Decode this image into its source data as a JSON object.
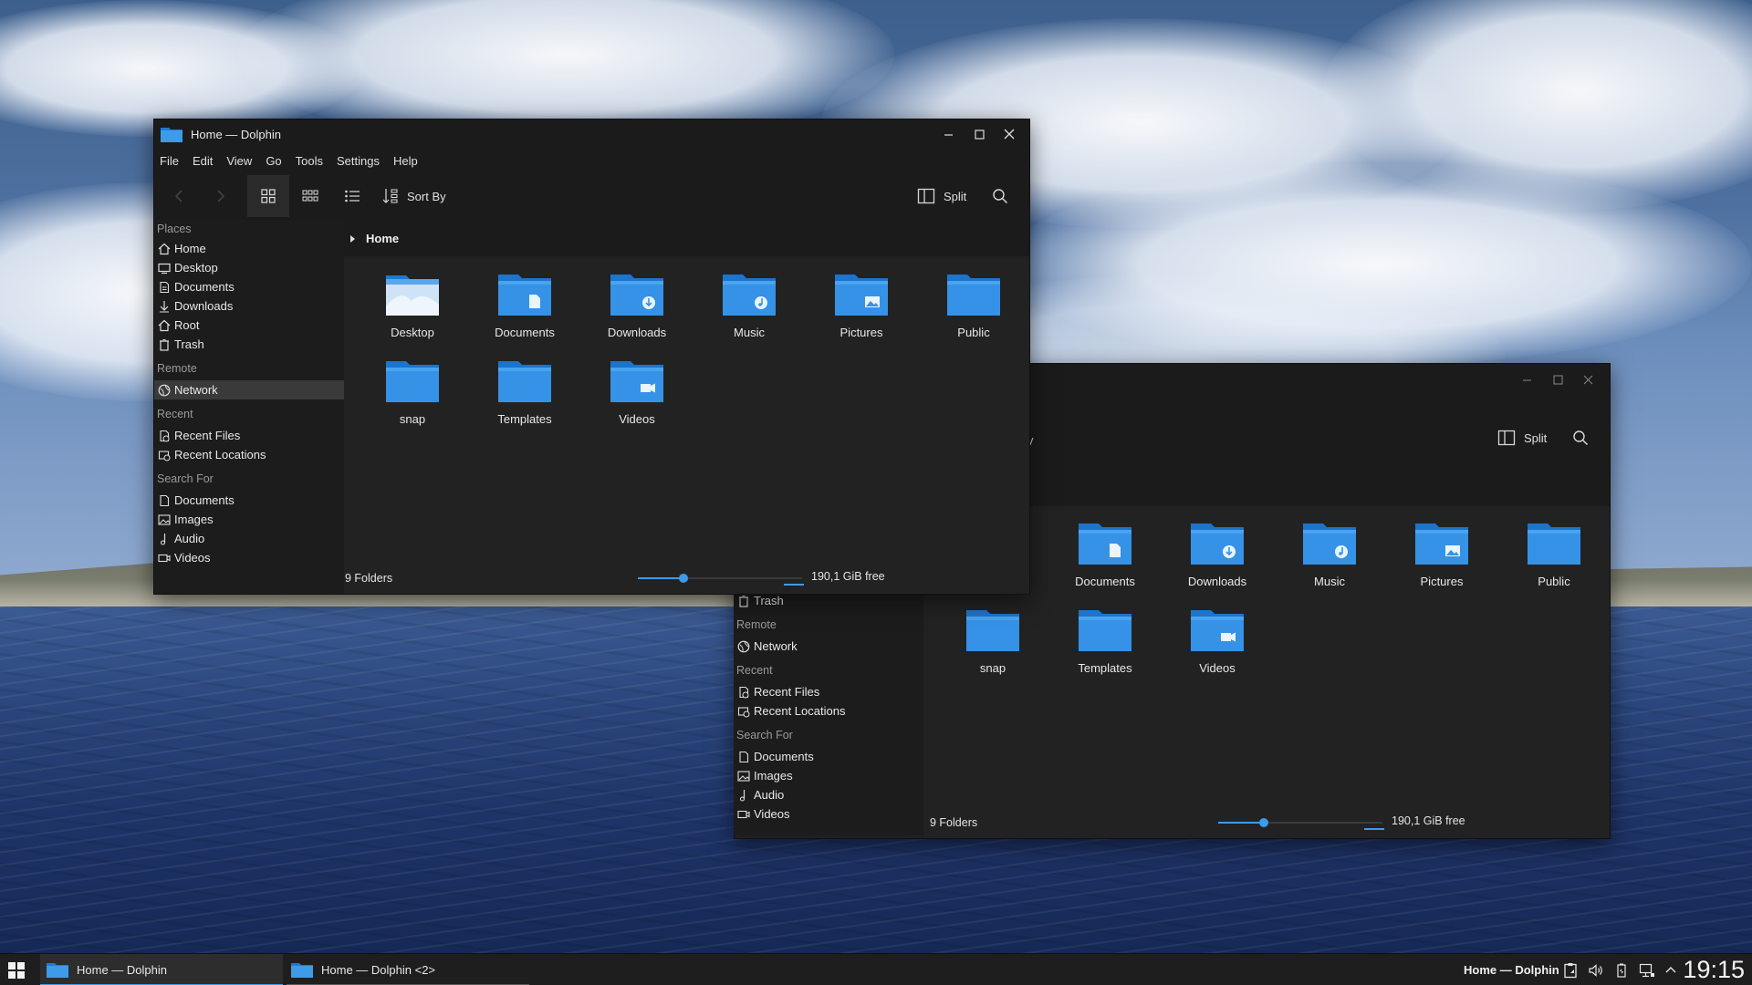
{
  "window_front": {
    "title": "Home — Dolphin",
    "menu": [
      "File",
      "Edit",
      "View",
      "Go",
      "Tools",
      "Settings",
      "Help"
    ],
    "toolbar": {
      "sort_label": "Sort By",
      "split_label": "Split"
    },
    "breadcrumb": "Home",
    "sidebar": {
      "places_heading": "Places",
      "places": [
        {
          "label": "Home",
          "icon": "home-icon"
        },
        {
          "label": "Desktop",
          "icon": "desktop-icon"
        },
        {
          "label": "Documents",
          "icon": "documents-icon"
        },
        {
          "label": "Downloads",
          "icon": "downloads-icon"
        },
        {
          "label": "Root",
          "icon": "root-icon"
        },
        {
          "label": "Trash",
          "icon": "trash-icon"
        }
      ],
      "remote_heading": "Remote",
      "remote": [
        {
          "label": "Network",
          "icon": "network-icon",
          "selected": true
        }
      ],
      "recent_heading": "Recent",
      "recent": [
        {
          "label": "Recent Files",
          "icon": "recent-files-icon"
        },
        {
          "label": "Recent Locations",
          "icon": "recent-locations-icon"
        }
      ],
      "search_heading": "Search For",
      "search": [
        {
          "label": "Documents",
          "icon": "search-documents-icon"
        },
        {
          "label": "Images",
          "icon": "images-icon"
        },
        {
          "label": "Audio",
          "icon": "audio-icon"
        },
        {
          "label": "Videos",
          "icon": "videos-icon"
        }
      ]
    },
    "folders": [
      {
        "label": "Desktop",
        "icon": "desktop-folder-icon"
      },
      {
        "label": "Documents",
        "icon": "documents-folder-icon"
      },
      {
        "label": "Downloads",
        "icon": "downloads-folder-icon"
      },
      {
        "label": "Music",
        "icon": "music-folder-icon"
      },
      {
        "label": "Pictures",
        "icon": "pictures-folder-icon"
      },
      {
        "label": "Public",
        "icon": "public-folder-icon"
      },
      {
        "label": "snap",
        "icon": "folder-icon"
      },
      {
        "label": "Templates",
        "icon": "templates-folder-icon"
      },
      {
        "label": "Videos",
        "icon": "videos-folder-icon"
      }
    ],
    "status": {
      "count": "9 Folders",
      "free": "190,1 GiB free",
      "zoom_fraction": 0.28
    }
  },
  "window_back": {
    "toolbar_fragment": "y",
    "toolbar": {
      "split_label": "Split"
    },
    "sidebar": {
      "places_visible": [
        {
          "label": "Trash",
          "icon": "trash-icon"
        }
      ],
      "remote_heading": "Remote",
      "remote": [
        {
          "label": "Network",
          "icon": "network-icon"
        }
      ],
      "recent_heading": "Recent",
      "recent": [
        {
          "label": "Recent Files",
          "icon": "recent-files-icon"
        },
        {
          "label": "Recent Locations",
          "icon": "recent-locations-icon"
        }
      ],
      "search_heading": "Search For",
      "search": [
        {
          "label": "Documents",
          "icon": "search-documents-icon"
        },
        {
          "label": "Images",
          "icon": "images-icon"
        },
        {
          "label": "Audio",
          "icon": "audio-icon"
        },
        {
          "label": "Videos",
          "icon": "videos-icon"
        }
      ]
    },
    "folders": [
      {
        "label": "Documents",
        "icon": "documents-folder-icon"
      },
      {
        "label": "Downloads",
        "icon": "downloads-folder-icon"
      },
      {
        "label": "Music",
        "icon": "music-folder-icon"
      },
      {
        "label": "Pictures",
        "icon": "pictures-folder-icon"
      },
      {
        "label": "Public",
        "icon": "public-folder-icon"
      },
      {
        "label": "snap",
        "icon": "folder-icon"
      },
      {
        "label": "Templates",
        "icon": "templates-folder-icon"
      },
      {
        "label": "Videos",
        "icon": "videos-folder-icon"
      }
    ],
    "status": {
      "count": "9 Folders",
      "free": "190,1 GiB free",
      "zoom_fraction": 0.28
    }
  },
  "taskbar": {
    "tasks": [
      {
        "label": "Home — Dolphin",
        "active": true
      },
      {
        "label": "Home — Dolphin <2>",
        "active": false
      }
    ],
    "active_window_title": "Home — Dolphin",
    "clock": "19:15",
    "tray_icons": [
      "clipboard-icon",
      "volume-icon",
      "battery-icon",
      "network-tray-icon",
      "expand-tray-icon"
    ]
  },
  "colors": {
    "accent": "#3d9be9",
    "folder_blue": "#2f8ee6",
    "window_bg": "#202020"
  }
}
